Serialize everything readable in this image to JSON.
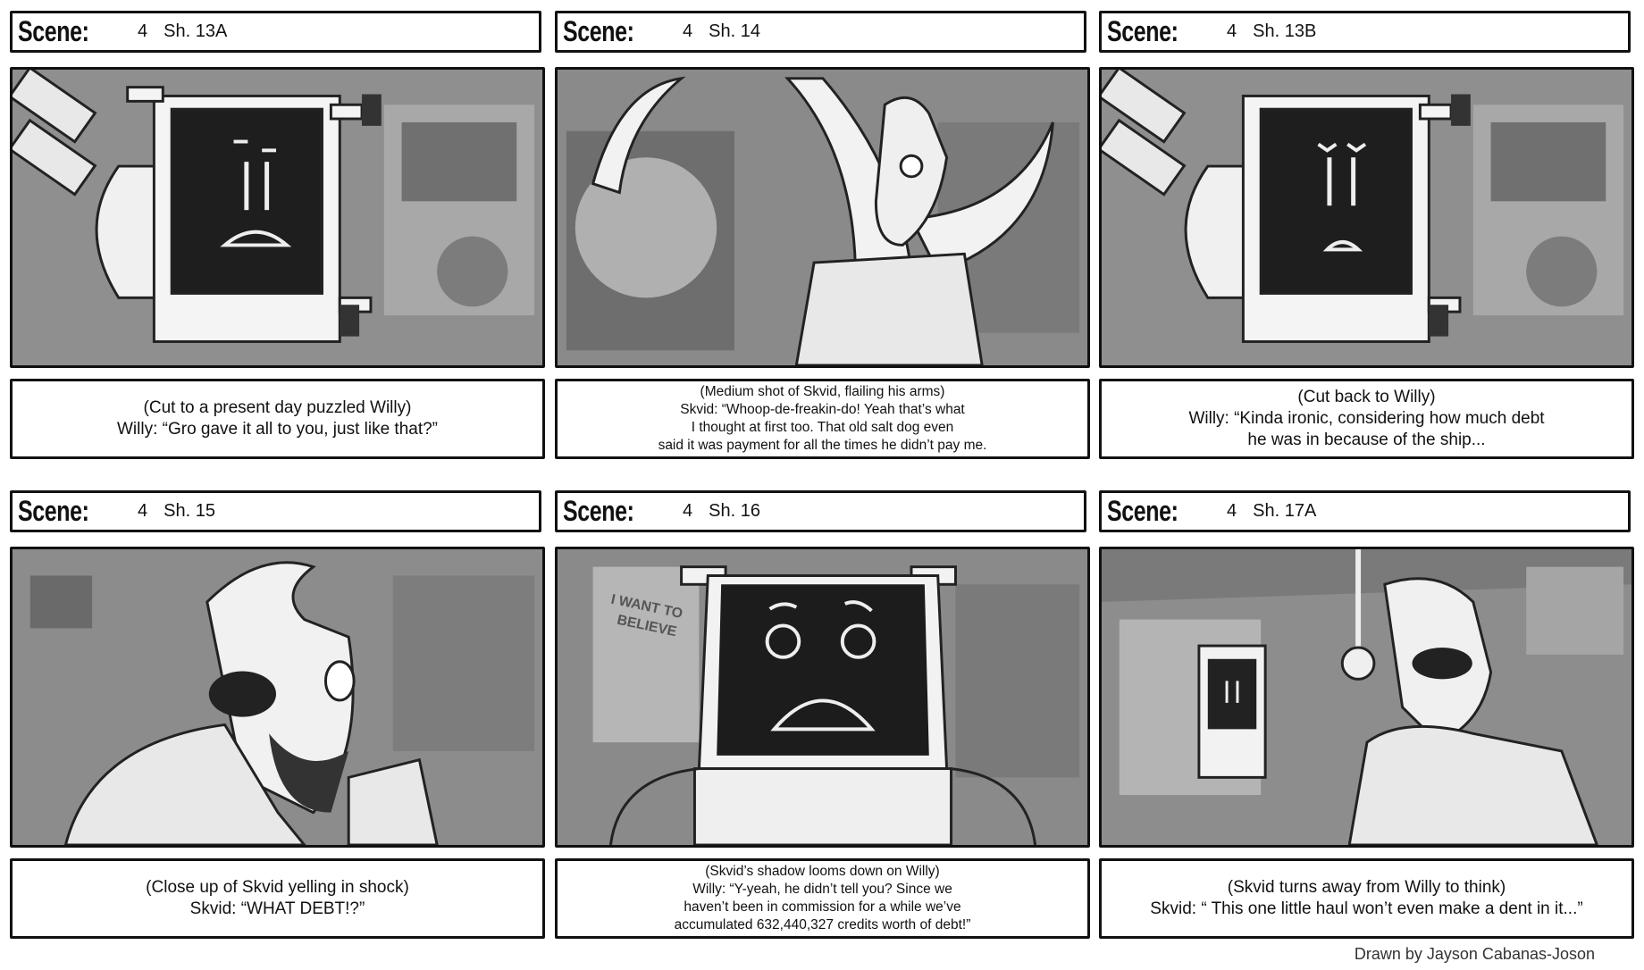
{
  "panels": [
    {
      "scene_label": "Scene:",
      "scene_number": "4",
      "shot": "Sh. 13A",
      "caption": [
        "(Cut to a present day puzzled Willy)",
        "Willy: “Gro gave it all to you, just like that?”"
      ]
    },
    {
      "scene_label": "Scene:",
      "scene_number": "4",
      "shot": "Sh. 14",
      "caption": [
        "(Medium shot of Skvid, flailing his arms)",
        "Skvid: “Whoop-de-freakin-do! Yeah that’s what",
        "I thought at first too. That old salt dog even",
        "said it was payment for all the times he didn’t pay me."
      ]
    },
    {
      "scene_label": "Scene:",
      "scene_number": "4",
      "shot": "Sh. 13B",
      "caption": [
        "(Cut back to Willy)",
        "Willy: “Kinda ironic, considering how much debt",
        "he was in because of the ship..."
      ]
    },
    {
      "scene_label": "Scene:",
      "scene_number": "4",
      "shot": "Sh. 15",
      "caption": [
        "(Close up of Skvid yelling in shock)",
        "Skvid: “WHAT DEBT!?”"
      ]
    },
    {
      "scene_label": "Scene:",
      "scene_number": "4",
      "shot": "Sh. 16",
      "poster_text": [
        "I WANT TO",
        "BELIEVE"
      ],
      "caption": [
        "(Skvid’s shadow looms down on Willy)",
        "Willy: “Y-yeah, he didn’t tell you? Since we",
        "haven’t been in commission for a while we’ve",
        "accumulated 632,440,327 credits worth of debt!”"
      ]
    },
    {
      "scene_label": "Scene:",
      "scene_number": "4",
      "shot": "Sh. 17A",
      "caption": [
        "(Skvid turns away from Willy to think)",
        "Skvid: “ This one little haul won’t even make a dent in it...”"
      ]
    }
  ],
  "credit": "Drawn by Jayson Cabanas-Joson",
  "colors": {
    "border": "#111111",
    "background": "#ffffff",
    "art_bg": "#9a9a9a"
  }
}
